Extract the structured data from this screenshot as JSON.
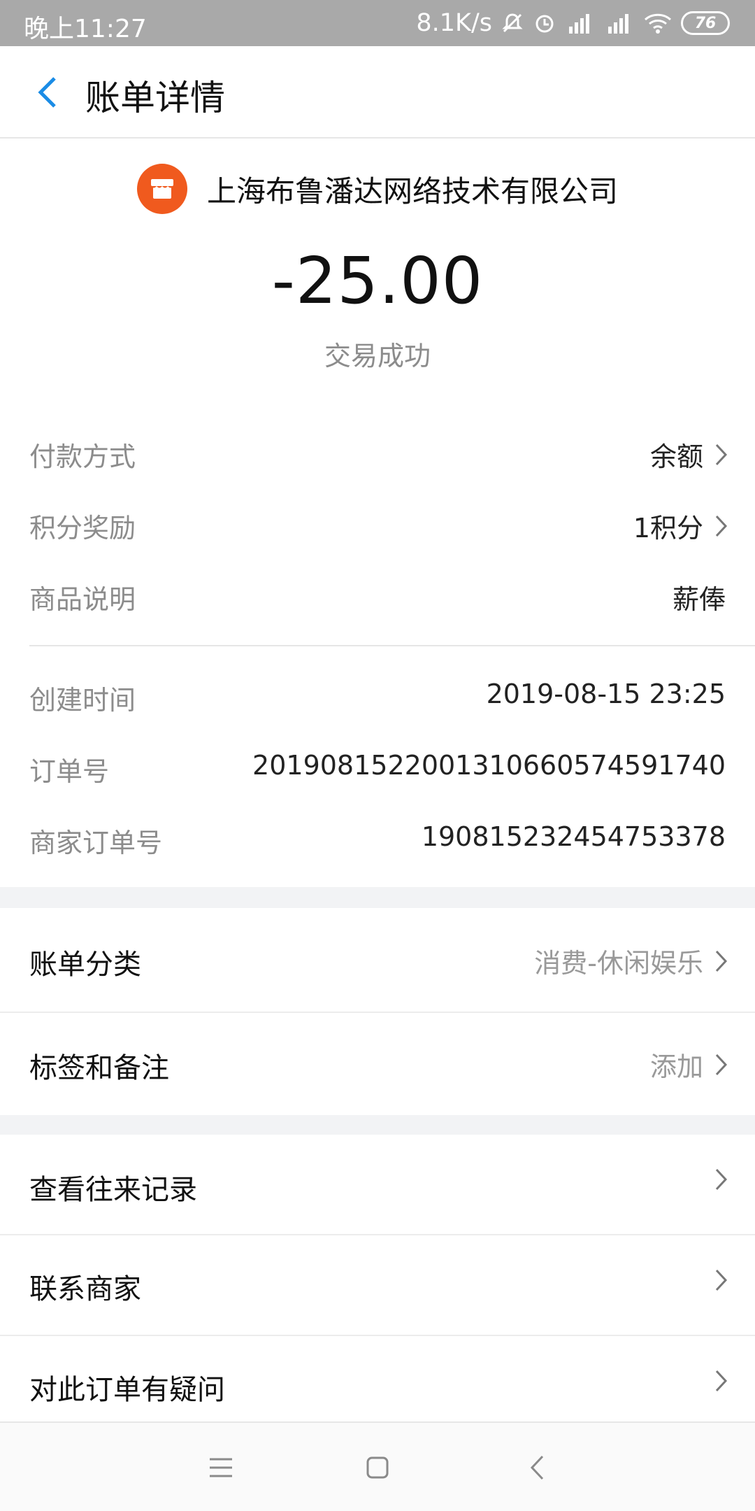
{
  "status_bar": {
    "time": "晚上11:27",
    "net_speed": "8.1K/s",
    "battery": "76"
  },
  "header": {
    "title": "账单详情"
  },
  "merchant": {
    "name": "上海布鲁潘达网络技术有限公司",
    "amount": "-25.00",
    "status": "交易成功"
  },
  "details": {
    "payment_method_label": "付款方式",
    "payment_method_value": "余额",
    "points_label": "积分奖励",
    "points_value": "1积分",
    "product_label": "商品说明",
    "product_value": "薪俸",
    "created_label": "创建时间",
    "created_value": "2019-08-15 23:25",
    "order_label": "订单号",
    "order_value": "20190815220013106605745917 40",
    "merchant_order_label": "商家订单号",
    "merchant_order_value": "190815232454753378"
  },
  "category": {
    "label": "账单分类",
    "value": "消费-休闲娱乐"
  },
  "tags": {
    "label": "标签和备注",
    "value": "添加"
  },
  "links": {
    "history": "查看往来记录",
    "contact": "联系商家",
    "question": "对此订单有疑问"
  },
  "colors": {
    "accent_blue": "#1a8ce6",
    "merchant_logo": "#f05a1e",
    "status_bar": "#a9a9a9"
  }
}
